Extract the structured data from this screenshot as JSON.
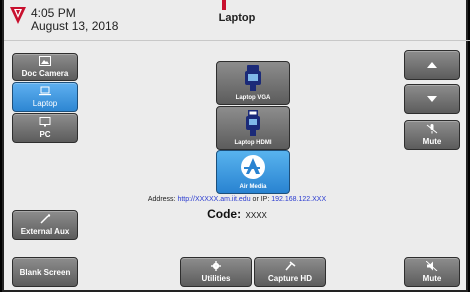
{
  "header": {
    "time": "4:05 PM",
    "date": "August 13, 2018",
    "title": "Laptop"
  },
  "left": {
    "doc_camera": "Doc Camera",
    "laptop": "Laptop",
    "pc": "PC",
    "external_aux": "External Aux",
    "blank_screen": "Blank Screen"
  },
  "sources": {
    "laptop_vga": "Laptop VGA",
    "laptop_hdmi": "Laptop HDMI",
    "air_media": "Air Media"
  },
  "info": {
    "address_label": "Address:",
    "address_url": "http://XXXXX.am.iit.edu",
    "address_or": "or IP:",
    "address_ip": "192.168.122.XXX",
    "code_label": "Code:",
    "code_value": "XXXX"
  },
  "right": {
    "mute_mic": "Mute",
    "mute_speaker": "Mute"
  },
  "bottom": {
    "utilities": "Utilities",
    "capture_hd": "Capture HD"
  },
  "colors": {
    "active_blue": "#2d86d2",
    "brand_red": "#c8102e",
    "link_blue": "#2a3bd0"
  }
}
